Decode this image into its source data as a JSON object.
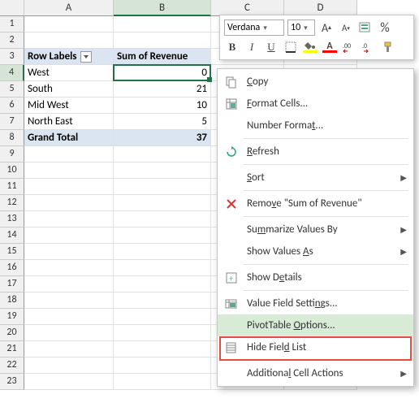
{
  "columns": [
    "A",
    "B",
    "C",
    "D"
  ],
  "rows": [
    "1",
    "2",
    "3",
    "4",
    "5",
    "6",
    "7",
    "8",
    "9",
    "10",
    "11",
    "12",
    "13",
    "14",
    "15",
    "16",
    "17",
    "18",
    "19",
    "20",
    "21",
    "22",
    "23"
  ],
  "pivot": {
    "row_labels_header": "Row Labels",
    "value_header": "Sum of Revenue",
    "data": [
      {
        "label": "West",
        "value": "0"
      },
      {
        "label": "South",
        "value": "21"
      },
      {
        "label": "Mid West",
        "value": "10"
      },
      {
        "label": "North East",
        "value": "5"
      }
    ],
    "total_label": "Grand Total",
    "total_value": "37"
  },
  "toolbar": {
    "font": "Verdana",
    "size": "10",
    "percent": "%"
  },
  "menu": {
    "copy": "Copy",
    "format_cells": "Format Cells...",
    "number_format": "Number Format...",
    "refresh": "Refresh",
    "sort": "Sort",
    "remove": "Remove \"Sum of Revenue\"",
    "summarize": "Summarize Values By",
    "show_values": "Show Values As",
    "show_details": "Show Details",
    "value_field": "Value Field Settings...",
    "pivot_options": "PivotTable Options...",
    "hide_field": "Hide Field List",
    "additional": "Additional Cell Actions"
  }
}
